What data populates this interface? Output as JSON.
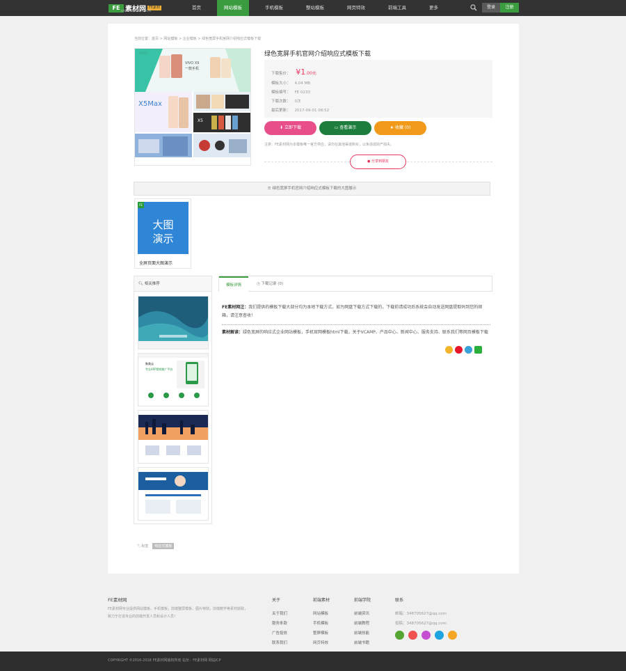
{
  "header": {
    "logo_mark": "FE",
    "logo_text": "素材网",
    "logo_badge": "FE素材",
    "logo_url": "WWW.FESUCAI.COM",
    "nav": [
      "首页",
      "网站模板",
      "手机模板",
      "整站模板",
      "网页特效",
      "前端工具",
      "更多"
    ],
    "active_index": 1,
    "login_label": "登录",
    "register_label": "注册"
  },
  "breadcrumb": "当前位置：首页 > 网站模板 > 企业模板 > 绿色宽屏手机官网介绍响应式模板下载",
  "product": {
    "title": "绿色宽屏手机官网介绍响应式模板下载",
    "price_label": "下载售价：",
    "price_symbol": "¥",
    "price_int": "1",
    "price_dec": ".00元",
    "size_label": "模板大小：",
    "size_value": "4.04 MB",
    "id_label": "模板编号：",
    "id_value": "FE 0233",
    "downloads_label": "下载次数：",
    "downloads_value": "0次",
    "updated_label": "最后更新：",
    "updated_value": "2017-09-01 08:52",
    "btn_download": "立即下载",
    "btn_demo": "查看演示",
    "btn_fav": "收藏 (0)",
    "notice": "注意：FE素材网为本模板唯一官方供应，请勿在其他渠道购买，以免造成财产损失。",
    "share_label": "分享到朋友"
  },
  "preview_texts": {
    "brand": "VIVO",
    "slogan1": "VIVO X9",
    "slogan2": "一款手机",
    "model1": "X5Max",
    "model2": "X5"
  },
  "demo_bar": "绿色宽屏手机官网介绍响应式模板下载的大图展示",
  "demo": {
    "corner": "FE",
    "text1": "大图",
    "text2": "演示",
    "caption": "全屏页面大图演示"
  },
  "related": {
    "title": "相关推荐",
    "thumb2_title": "聚美云",
    "thumb2_sub": "专业APP营销推广平台"
  },
  "tabs": {
    "detail": "模板详情",
    "history": "下载记录 (0)"
  },
  "description": {
    "label1": "FE素材网注：",
    "text1": "我们提供的模板下载大部分均为本地下载方式，如为网盘下载方式下载的，下载前请成功后系统会自动发送网盘提取码到您的邮箱，请注意查收！",
    "label2": "素材解读：",
    "text2": "绿色宽屏的响应式企业网站模板，手机官网模板html下载，关于VCAMP、产品中心、新闻中心、服务支持、联系我们等网页模板下载"
  },
  "tags": {
    "label": "标签",
    "items": [
      "响应式模板"
    ]
  },
  "footer": {
    "brand": "FE素材网",
    "about": "FE素材网专业提供网站模板，手机模板，前端整屏模板，图片特效，前端教学等素材获取，致力于打造专业的前端开发人员和设计人员！",
    "cols": [
      {
        "title": "关于",
        "items": [
          "关于我们",
          "服务条款",
          "广告投放",
          "联系我们"
        ]
      },
      {
        "title": "前端素材",
        "items": [
          "网站模板",
          "手机模板",
          "整屏模板",
          "网页特效"
        ]
      },
      {
        "title": "前端学院",
        "items": [
          "前端资讯",
          "前端教程",
          "前端技能",
          "前端书籍"
        ]
      }
    ],
    "contact_title": "联系",
    "contact1": "邮箱：348705627@qq.com",
    "contact2": "投稿：348705627@qq.com",
    "copyright": "COPYRIGHT ©2016-2018 FE素材网版权所有 站长：FE素材网 网站ICP"
  },
  "colors": {
    "green": "#3a9b3f",
    "pink": "#e8355c",
    "dark_green": "#1c7d3c",
    "orange": "#f19a1a",
    "topbar": "#333333"
  }
}
